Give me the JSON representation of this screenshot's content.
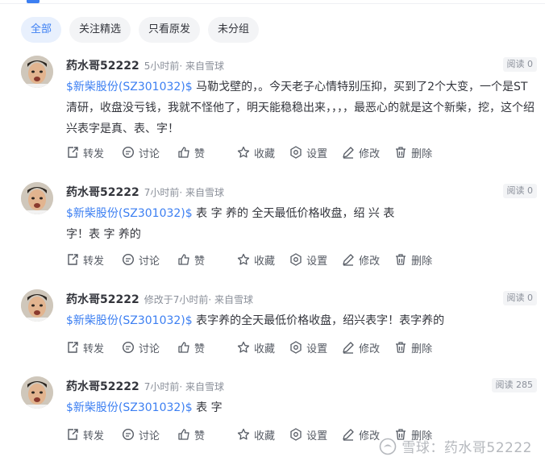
{
  "tabs": [
    {
      "label": "全部",
      "active": true
    },
    {
      "label": "关注精选",
      "active": false
    },
    {
      "label": "只看原发",
      "active": false
    },
    {
      "label": "未分组",
      "active": false
    }
  ],
  "posts": [
    {
      "author": "药水哥52222",
      "time": "5小时前· 来自雪球",
      "reads": "阅读 0",
      "stock": "$新柴股份(SZ301032)$",
      "text": " 马勒戈壁的，。今天老子心情特别压抑，买到了2个大变，一个是ST清研，收盘没亏钱，我就不怪他了，明天能稳稳出来，，，，最恶心的就是这个新柴，挖，这个绍兴表字是真、表、字！"
    },
    {
      "author": "药水哥52222",
      "time": "7小时前· 来自雪球",
      "reads": "阅读 0",
      "stock": "$新柴股份(SZ301032)$",
      "text": " 表 字 养的 全天最低价格收盘，绍 兴 表 字！表 字 养的"
    },
    {
      "author": "药水哥52222",
      "time": "修改于7小时前· 来自雪球",
      "reads": "阅读 0",
      "stock": "$新柴股份(SZ301032)$",
      "text": " 表字养的全天最低价格收盘，绍兴表字！表字养的"
    },
    {
      "author": "药水哥52222",
      "time": "7小时前· 来自雪球",
      "reads": "阅读 285",
      "stock": "$新柴股份(SZ301032)$",
      "text": " 表 字"
    }
  ],
  "actions": {
    "repost": "转发",
    "comment": "讨论",
    "like": "赞",
    "favorite": "收藏",
    "settings": "设置",
    "edit": "修改",
    "delete": "删除"
  },
  "watermark": "雪球：药水哥52222",
  "colors": {
    "accent": "#3c7ff2",
    "text": "#33353c",
    "muted": "#8a8f99"
  }
}
